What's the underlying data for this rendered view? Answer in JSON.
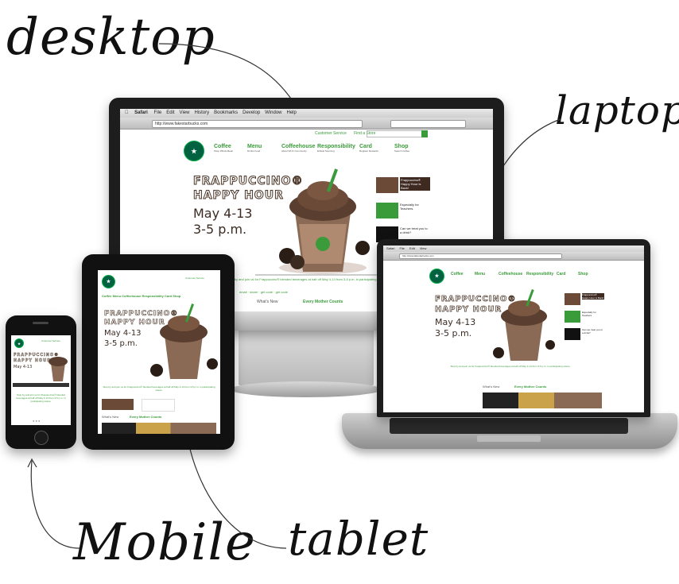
{
  "labels": {
    "desktop": "desktop",
    "laptop": "laptop",
    "mobile": "Mobile",
    "tablet": "tablet"
  },
  "site": {
    "url": "http://www.fakestarbucks.com",
    "menubar": [
      "Safari",
      "File",
      "Edit",
      "View",
      "History",
      "Bookmarks",
      "Develop",
      "Window",
      "Help"
    ],
    "top_links": [
      "Customer Service",
      "Find a Store"
    ],
    "nav": [
      {
        "label": "Coffee",
        "sub": "Shop Whole Bean"
      },
      {
        "label": "Menu",
        "sub": "Drinks Food"
      },
      {
        "label": "Coffeehouse",
        "sub": "About Wi-Fi Community"
      },
      {
        "label": "Responsibility",
        "sub": "Ethical Sourcing"
      },
      {
        "label": "Card",
        "sub": "Register Rewards"
      },
      {
        "label": "Shop",
        "sub": "Search Coffee"
      }
    ],
    "promo": {
      "title_line1": "FRAPPUCCINO®",
      "title_line2": "HAPPY HOUR",
      "date": "May 4-13",
      "time": "3-5 p.m."
    },
    "side_items": [
      "Frappuccino® Happy Hour is Back!",
      "Especially for Teachers.",
      "Can we treat you to a drink?"
    ],
    "caption": "Stop by and join us for Frappuccino® blended beverages at half off May 4-13 from 3-5 p.m. in participating stores.",
    "whats_new": "What's New",
    "every_mother": "Every Mother Counts",
    "share": [
      "email",
      "share",
      "get code",
      "get code"
    ]
  },
  "colors": {
    "brand_green": "#006241",
    "link_green": "#3a9b3a",
    "coffee_brown": "#6b4a37"
  }
}
